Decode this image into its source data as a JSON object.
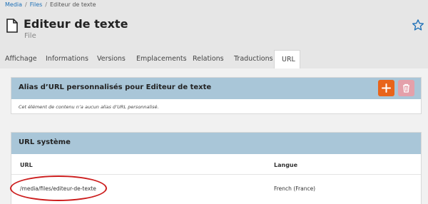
{
  "breadcrumb": [
    "Media",
    "Files",
    "Editeur de texte"
  ],
  "page": {
    "title": "Editeur de texte",
    "subtitle": "File"
  },
  "tabs": [
    {
      "label": "Affichage"
    },
    {
      "label": "Informations"
    },
    {
      "label": "Versions"
    },
    {
      "label": "Emplacements"
    },
    {
      "label": "Relations"
    },
    {
      "label": "Traductions"
    },
    {
      "label": "URL",
      "active": true
    }
  ],
  "alias_panel": {
    "title": "Alias d’URL personnalisés pour Editeur de texte",
    "empty_message": "Cet élément de contenu n’a aucun alias d’URL personnalisé.",
    "add_icon": "plus-icon",
    "delete_icon": "trash-icon"
  },
  "system_panel": {
    "title": "URL système",
    "columns": {
      "url": "URL",
      "language": "Langue"
    },
    "rows": [
      {
        "url": "/media/files/editeur-de-texte",
        "language": "French (France)"
      }
    ]
  },
  "colors": {
    "panel_header": "#a9c6d8",
    "add_button": "#e8641b",
    "delete_button": "#e4a0aa",
    "annotation": "#cc1d1d"
  }
}
